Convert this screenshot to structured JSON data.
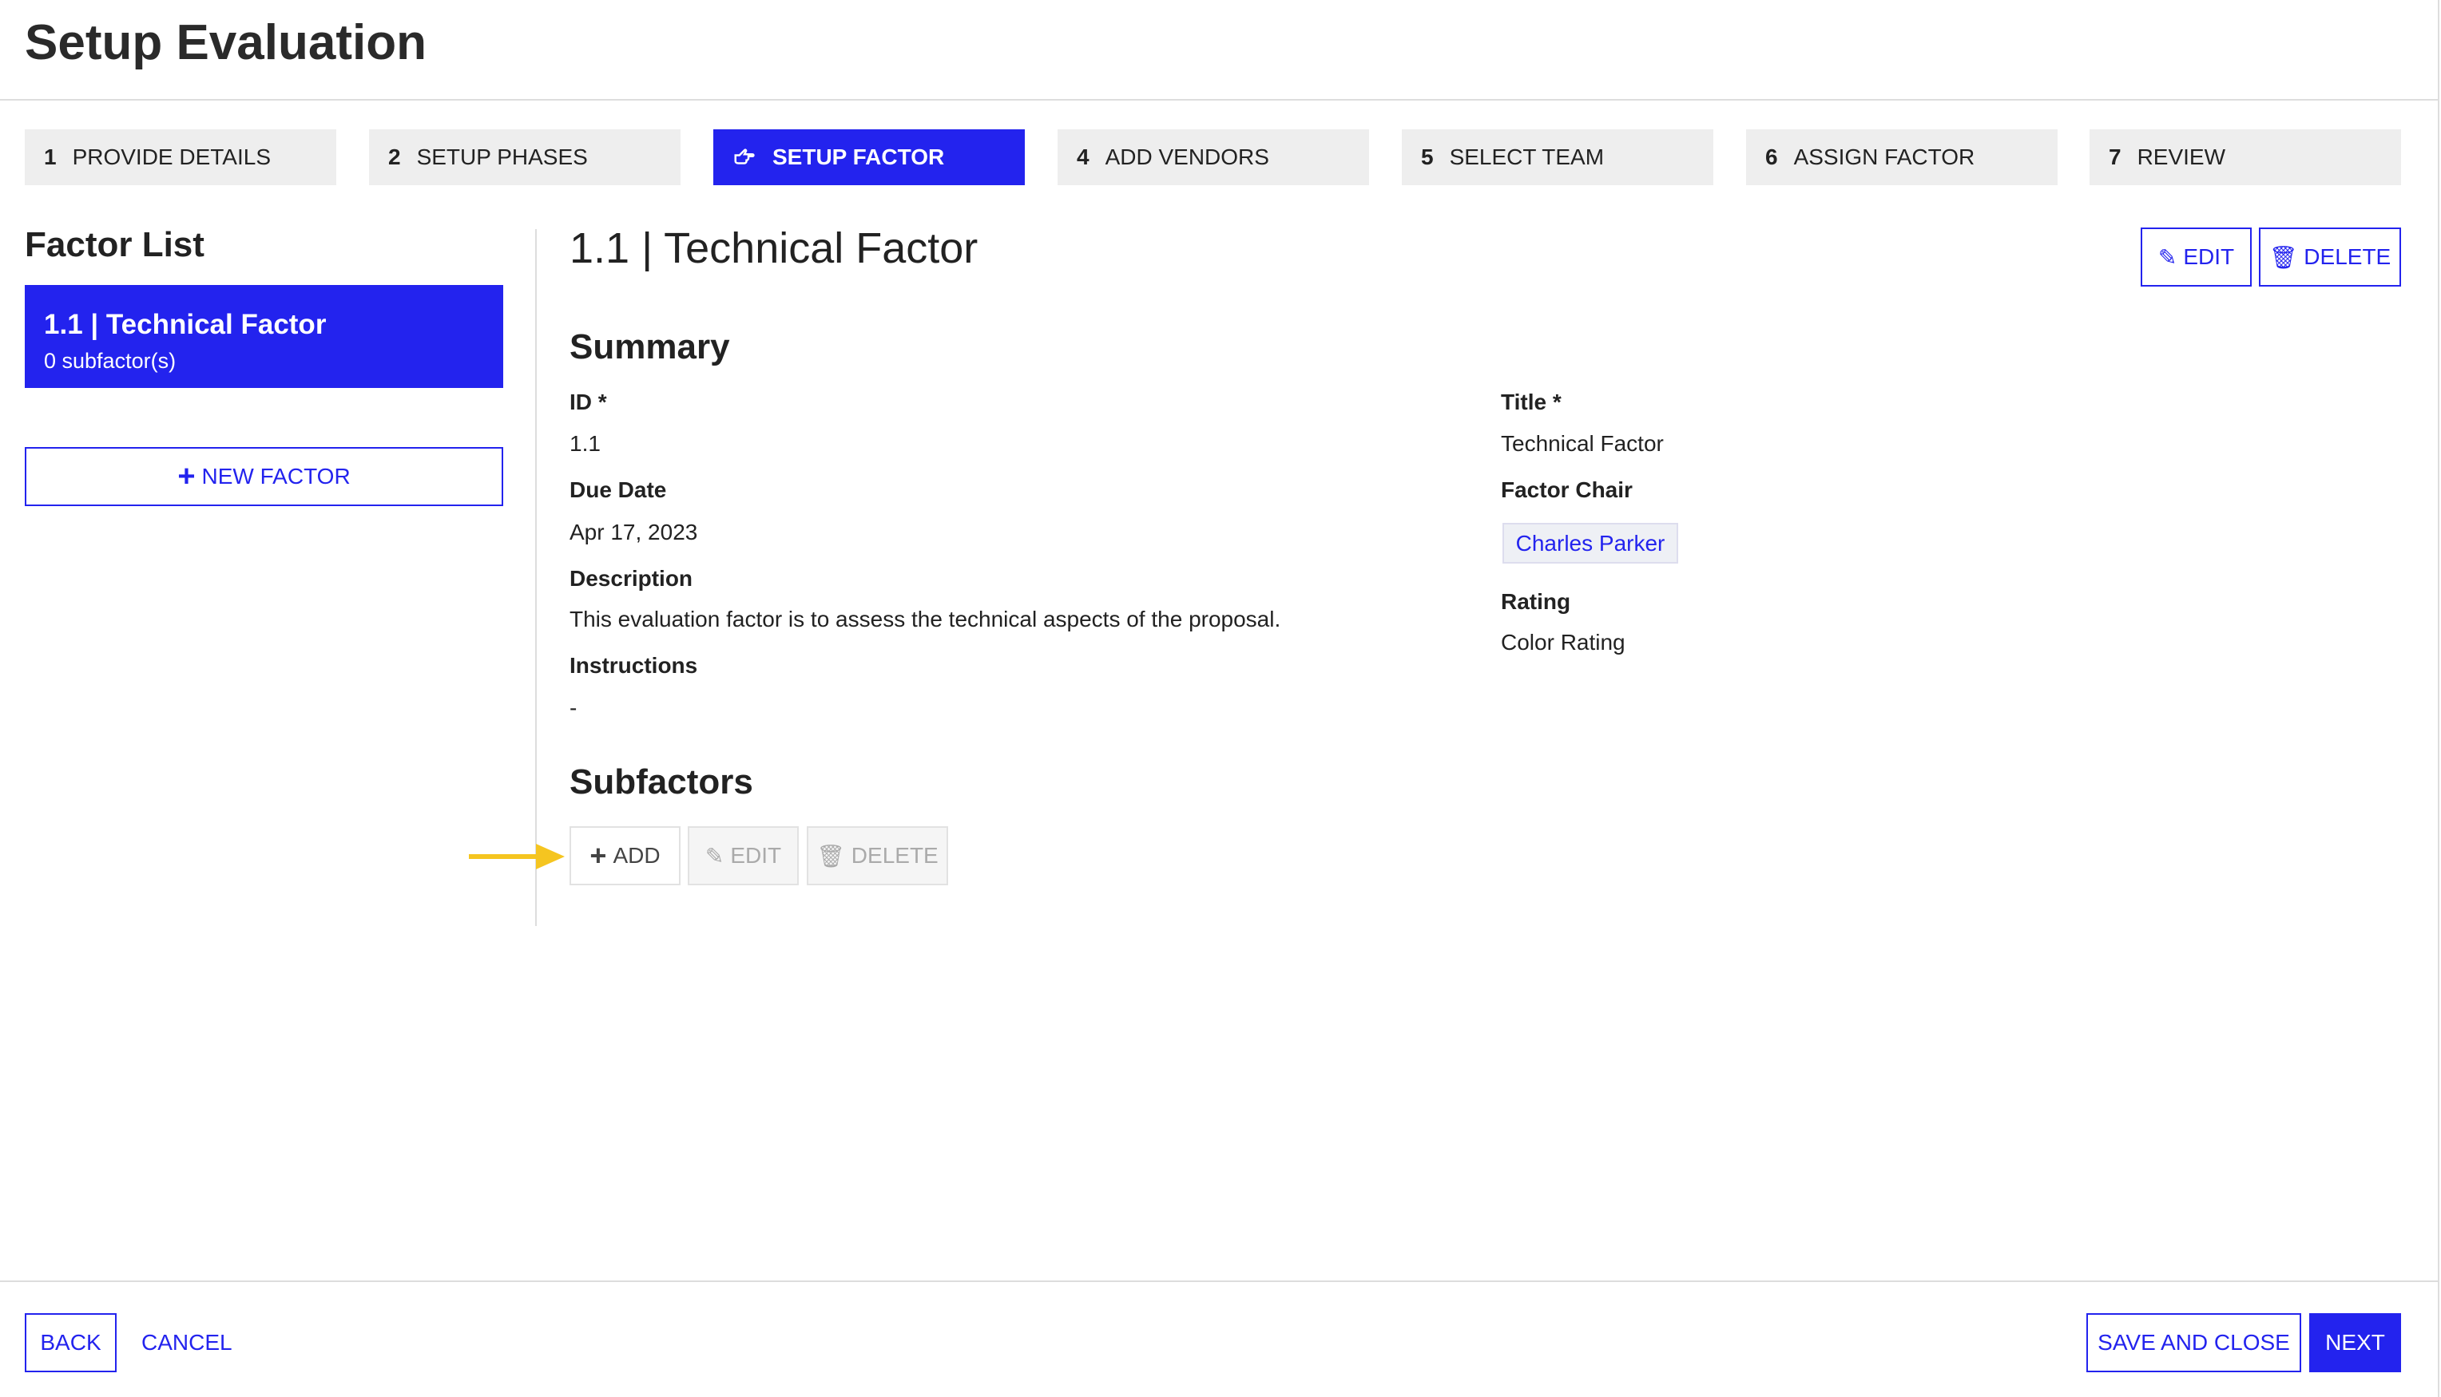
{
  "page": {
    "title": "Setup Evaluation"
  },
  "steps": [
    {
      "num": "1",
      "label": "PROVIDE DETAILS",
      "active": false
    },
    {
      "num": "2",
      "label": "SETUP PHASES",
      "active": false
    },
    {
      "num": "",
      "label": "SETUP FACTOR",
      "active": true,
      "icon": "hand-point-right-icon"
    },
    {
      "num": "4",
      "label": "ADD VENDORS",
      "active": false
    },
    {
      "num": "5",
      "label": "SELECT TEAM",
      "active": false
    },
    {
      "num": "6",
      "label": "ASSIGN FACTOR",
      "active": false
    },
    {
      "num": "7",
      "label": "REVIEW",
      "active": false
    }
  ],
  "sidebar": {
    "heading": "Factor List",
    "items": [
      {
        "title": "1.1 | Technical Factor",
        "subtitle": "0  subfactor(s)"
      }
    ],
    "new_factor": "NEW FACTOR"
  },
  "main": {
    "title": "1.1 | Technical Factor",
    "edit": "EDIT",
    "delete": "DELETE",
    "summary_heading": "Summary",
    "fields": {
      "id_label": "ID *",
      "id": "1.1",
      "due_label": "Due Date",
      "due": "Apr 17, 2023",
      "desc_label": "Description",
      "desc": "This evaluation factor is to assess the technical aspects of the proposal.",
      "instr_label": "Instructions",
      "instr": "-",
      "title_label": "Title *",
      "title": "Technical Factor",
      "chair_label": "Factor Chair",
      "chair": "Charles Parker",
      "rating_label": "Rating",
      "rating": "Color Rating"
    },
    "subfactors_heading": "Subfactors",
    "sub_add": "ADD",
    "sub_edit": "EDIT",
    "sub_delete": "DELETE"
  },
  "footer": {
    "back": "BACK",
    "cancel": "CANCEL",
    "save_close": "SAVE AND CLOSE",
    "next": "NEXT"
  },
  "colors": {
    "accent": "#2323ee",
    "arrow": "#f5c520"
  }
}
